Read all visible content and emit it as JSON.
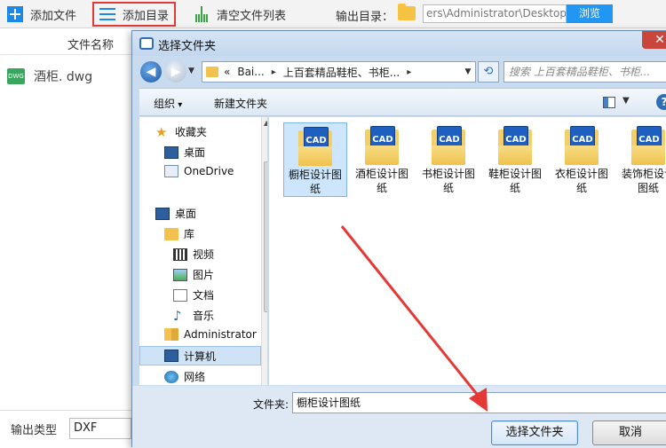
{
  "toolbar": {
    "add_file": "添加文件",
    "add_dir": "添加目录",
    "clear_list": "清空文件列表",
    "output_dir_label": "输出目录：",
    "output_path": "ers\\Administrator\\Desktop",
    "browse": "浏览"
  },
  "file_list": {
    "header": "文件名称",
    "files": [
      {
        "icon": "DWG",
        "name": "酒柜. dwg"
      }
    ]
  },
  "bottom": {
    "output_type_label": "输出类型",
    "output_type_value": "DXF"
  },
  "dialog": {
    "title": "选择文件夹",
    "close": "✕",
    "address": {
      "prefix": "«",
      "segment1": "Bai...",
      "sep": "▸",
      "segment2": "上百套精品鞋柜、书柜...",
      "sep2": "▸"
    },
    "search_placeholder": "搜索 上百套精品鞋柜、书柜...",
    "commands": {
      "organize": "组织",
      "new_folder": "新建文件夹"
    },
    "nav_items": [
      {
        "label": "收藏夹",
        "icon": "star-icon"
      },
      {
        "label": "桌面",
        "icon": "desktop-icon"
      },
      {
        "label": "OneDrive",
        "icon": "cloud-icon"
      },
      {
        "label": "桌面",
        "icon": "desktop-icon"
      },
      {
        "label": "库",
        "icon": "library-icon"
      },
      {
        "label": "视频",
        "icon": "video-icon"
      },
      {
        "label": "图片",
        "icon": "picture-icon"
      },
      {
        "label": "文档",
        "icon": "document-icon"
      },
      {
        "label": "音乐",
        "icon": "music-icon"
      },
      {
        "label": "Administrator",
        "icon": "user-folder-icon"
      },
      {
        "label": "计算机",
        "icon": "computer-icon"
      },
      {
        "label": "网络",
        "icon": "network-icon"
      }
    ],
    "folders": [
      {
        "label": "橱柜设计图纸",
        "selected": true
      },
      {
        "label": "酒柜设计图纸",
        "selected": false
      },
      {
        "label": "书柜设计图纸",
        "selected": false
      },
      {
        "label": "鞋柜设计图纸",
        "selected": false
      },
      {
        "label": "衣柜设计图纸",
        "selected": false
      },
      {
        "label": "装饰柜设计图纸",
        "selected": false
      }
    ],
    "folder_icon_text": "CAD",
    "folder_label": "文件夹:",
    "folder_value": "橱柜设计图纸",
    "select_button": "选择文件夹",
    "cancel_button": "取消"
  },
  "colors": {
    "accent_blue": "#2196f3",
    "highlight_red": "#e53935",
    "arrow_red": "#e53935",
    "dialog_bg": "#dde8f4"
  }
}
